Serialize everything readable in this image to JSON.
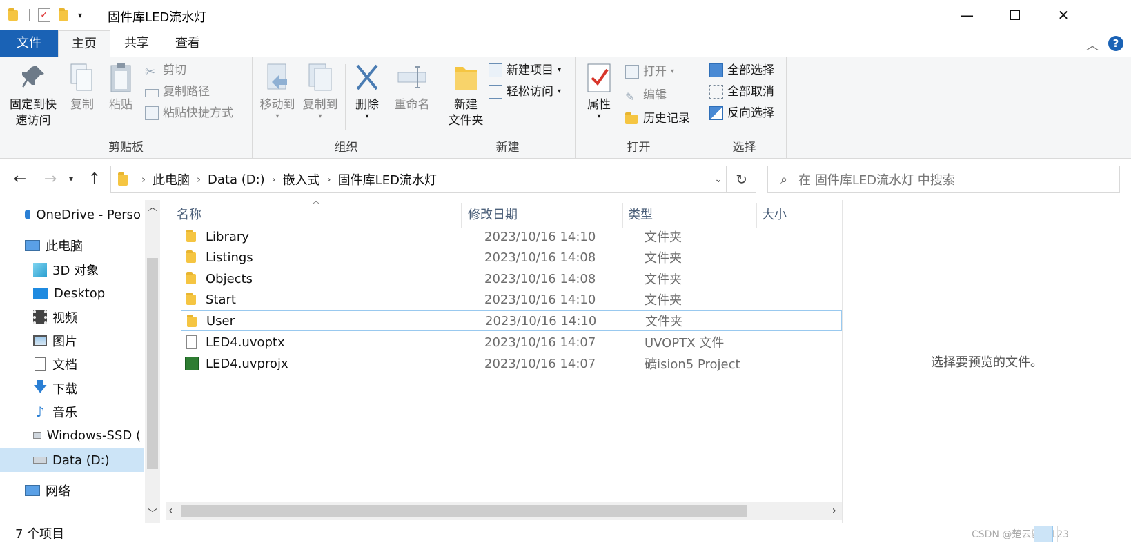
{
  "window": {
    "title": "固件库LED流水灯",
    "min_symbol": "—",
    "max_symbol": "☐",
    "close_symbol": "✕"
  },
  "tabs": {
    "file": "文件",
    "home": "主页",
    "share": "共享",
    "view": "查看"
  },
  "ribbon": {
    "clipboard": {
      "pin_line1": "固定到快",
      "pin_line2": "速访问",
      "copy": "复制",
      "paste": "粘贴",
      "cut": "剪切",
      "copy_path": "复制路径",
      "paste_shortcut": "粘贴快捷方式",
      "label": "剪贴板"
    },
    "organize": {
      "move_to": "移动到",
      "copy_to": "复制到",
      "delete": "删除",
      "rename": "重命名",
      "label": "组织"
    },
    "new": {
      "new_folder_line1": "新建",
      "new_folder_line2": "文件夹",
      "new_item": "新建项目",
      "easy_access": "轻松访问",
      "label": "新建"
    },
    "open": {
      "properties": "属性",
      "open": "打开",
      "edit": "编辑",
      "history": "历史记录",
      "label": "打开"
    },
    "select": {
      "select_all": "全部选择",
      "select_none": "全部取消",
      "invert": "反向选择",
      "label": "选择"
    }
  },
  "address": {
    "crumbs": [
      "此电脑",
      "Data (D:)",
      "嵌入式",
      "固件库LED流水灯"
    ],
    "search_placeholder": "在 固件库LED流水灯 中搜索"
  },
  "nav": {
    "items": [
      {
        "label": "OneDrive - Perso",
        "icon": "cloud-icon"
      },
      {
        "label": "此电脑",
        "icon": "computer-icon"
      },
      {
        "label": "3D 对象",
        "icon": "cube-icon"
      },
      {
        "label": "Desktop",
        "icon": "desktop-icon"
      },
      {
        "label": "视频",
        "icon": "video-icon"
      },
      {
        "label": "图片",
        "icon": "picture-icon"
      },
      {
        "label": "文档",
        "icon": "document-icon"
      },
      {
        "label": "下载",
        "icon": "download-icon"
      },
      {
        "label": "音乐",
        "icon": "music-icon"
      },
      {
        "label": "Windows-SSD (",
        "icon": "drive-icon"
      },
      {
        "label": "Data (D:)",
        "icon": "drive-icon"
      },
      {
        "label": "网络",
        "icon": "network-icon"
      }
    ],
    "selected": "Data (D:)"
  },
  "columns": {
    "name": "名称",
    "date": "修改日期",
    "type": "类型",
    "size": "大小"
  },
  "files": [
    {
      "name": "Library",
      "date": "2023/10/16 14:10",
      "type": "文件夹",
      "kind": "folder"
    },
    {
      "name": "Listings",
      "date": "2023/10/16 14:08",
      "type": "文件夹",
      "kind": "folder"
    },
    {
      "name": "Objects",
      "date": "2023/10/16 14:08",
      "type": "文件夹",
      "kind": "folder"
    },
    {
      "name": "Start",
      "date": "2023/10/16 14:10",
      "type": "文件夹",
      "kind": "folder"
    },
    {
      "name": "User",
      "date": "2023/10/16 14:10",
      "type": "文件夹",
      "kind": "folder"
    },
    {
      "name": "LED4.uvoptx",
      "date": "2023/10/16 14:07",
      "type": "UVOPTX 文件",
      "kind": "file"
    },
    {
      "name": "LED4.uvprojx",
      "date": "2023/10/16 14:07",
      "type": "礦ision5 Project",
      "kind": "project"
    }
  ],
  "preview_text": "选择要预览的文件。",
  "status": {
    "count": "7 个项目",
    "watermark": "CSDN @楚云骑士123"
  },
  "colors": {
    "accent": "#1a62b5",
    "selection": "#cce4f7",
    "folder": "#f5c542"
  }
}
